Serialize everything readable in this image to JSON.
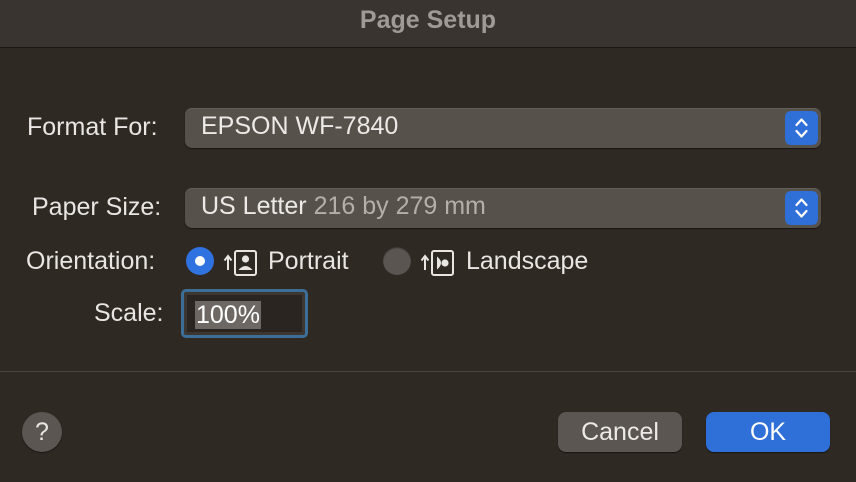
{
  "window": {
    "title": "Page Setup"
  },
  "format_for": {
    "label": "Format For:",
    "value": "EPSON WF-7840"
  },
  "paper_size": {
    "label": "Paper Size:",
    "value": "US Letter",
    "dimensions": "216 by 279 mm"
  },
  "orientation": {
    "label": "Orientation:",
    "selected": "Portrait",
    "options": [
      {
        "label": "Portrait",
        "icon": "portrait-orientation-icon"
      },
      {
        "label": "Landscape",
        "icon": "landscape-orientation-icon"
      }
    ]
  },
  "scale": {
    "label": "Scale:",
    "value": "100%"
  },
  "footer": {
    "help": "?",
    "cancel_label": "Cancel",
    "ok_label": "OK"
  },
  "colors": {
    "accent": "#2f6fd8",
    "background": "#2f2924",
    "control": "#57514c"
  }
}
